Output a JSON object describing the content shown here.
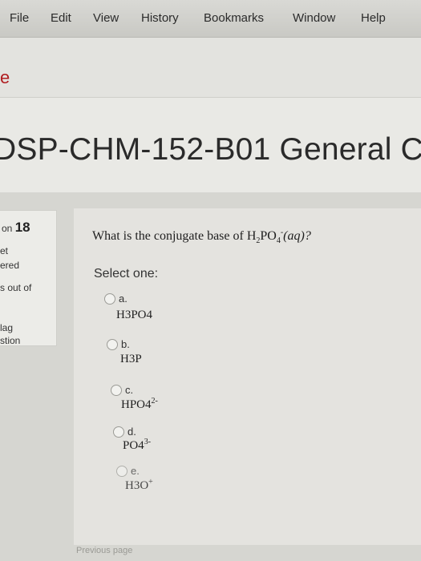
{
  "menubar": {
    "items": [
      "File",
      "Edit",
      "View",
      "History",
      "Bookmarks",
      "Window",
      "Help"
    ]
  },
  "tab": {
    "fragment": "e"
  },
  "course": {
    "title": "DSP-CHM-152-B01 General C"
  },
  "info": {
    "question_prefix": "on",
    "question_number": "18",
    "line1": "et",
    "line2": "ered",
    "line3": "s out of",
    "flag_line1": "lag",
    "flag_line2": "stion"
  },
  "question": {
    "prompt_prefix": "What is the conjugate base of H",
    "prompt_sub1": "2",
    "prompt_mid": "PO",
    "prompt_sub2": "4",
    "prompt_sup": "-",
    "prompt_suffix": "(aq)?",
    "select_label": "Select one:",
    "options": [
      {
        "letter": "a.",
        "base": "H3PO4"
      },
      {
        "letter": "b.",
        "base": "H3P"
      },
      {
        "letter": "c.",
        "base": "HPO4",
        "charge": "2-"
      },
      {
        "letter": "d.",
        "base": "PO4",
        "charge": "3-"
      },
      {
        "letter": "e.",
        "base": "H3O",
        "charge": "+"
      }
    ]
  },
  "footer": {
    "prev_label": "Previous page"
  }
}
